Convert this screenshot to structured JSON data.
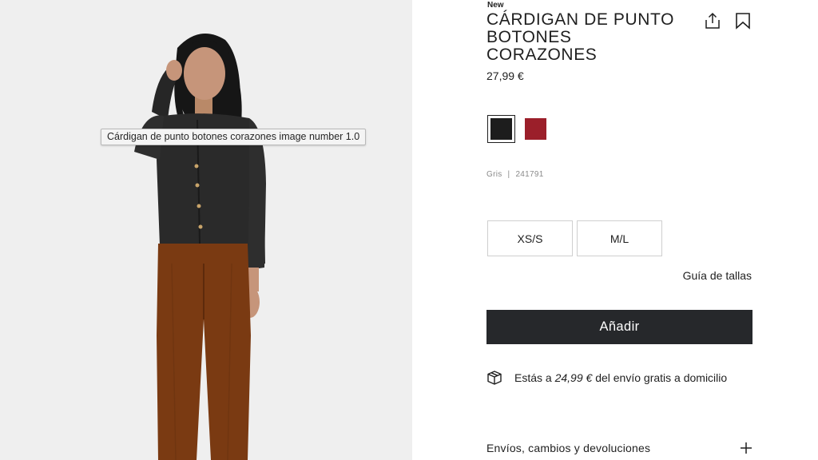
{
  "gallery": {
    "tooltip": "Cárdigan de punto botones corazones image number 1.0"
  },
  "product": {
    "badge": "New",
    "title_lines": [
      "CÁRDIGAN DE PUNTO",
      "BOTONES",
      "CORAZONES"
    ],
    "price": "27,99 €",
    "color_name": "Gris",
    "separator": "|",
    "reference": "241791",
    "colors": [
      {
        "name": "black",
        "hex": "#1d1d1d",
        "selected": true
      },
      {
        "name": "red",
        "hex": "#9b1f2a",
        "selected": false
      }
    ],
    "sizes": [
      "XS/S",
      "M/L"
    ],
    "size_guide_label": "Guía de tallas",
    "add_button_label": "Añadir"
  },
  "shipping": {
    "prefix": "Estás a",
    "amount": "24,99 €",
    "suffix": "del envío gratis a domicilio",
    "icon": "box-icon"
  },
  "accordion": {
    "label": "Envíos, cambios y devoluciones",
    "icon": "plus-icon"
  },
  "icons": {
    "share": "share-icon",
    "bookmark": "bookmark-icon"
  },
  "colors": {
    "panel_bg": "#efefef",
    "button_dark": "#26282b",
    "text": "#1f1f1f"
  }
}
